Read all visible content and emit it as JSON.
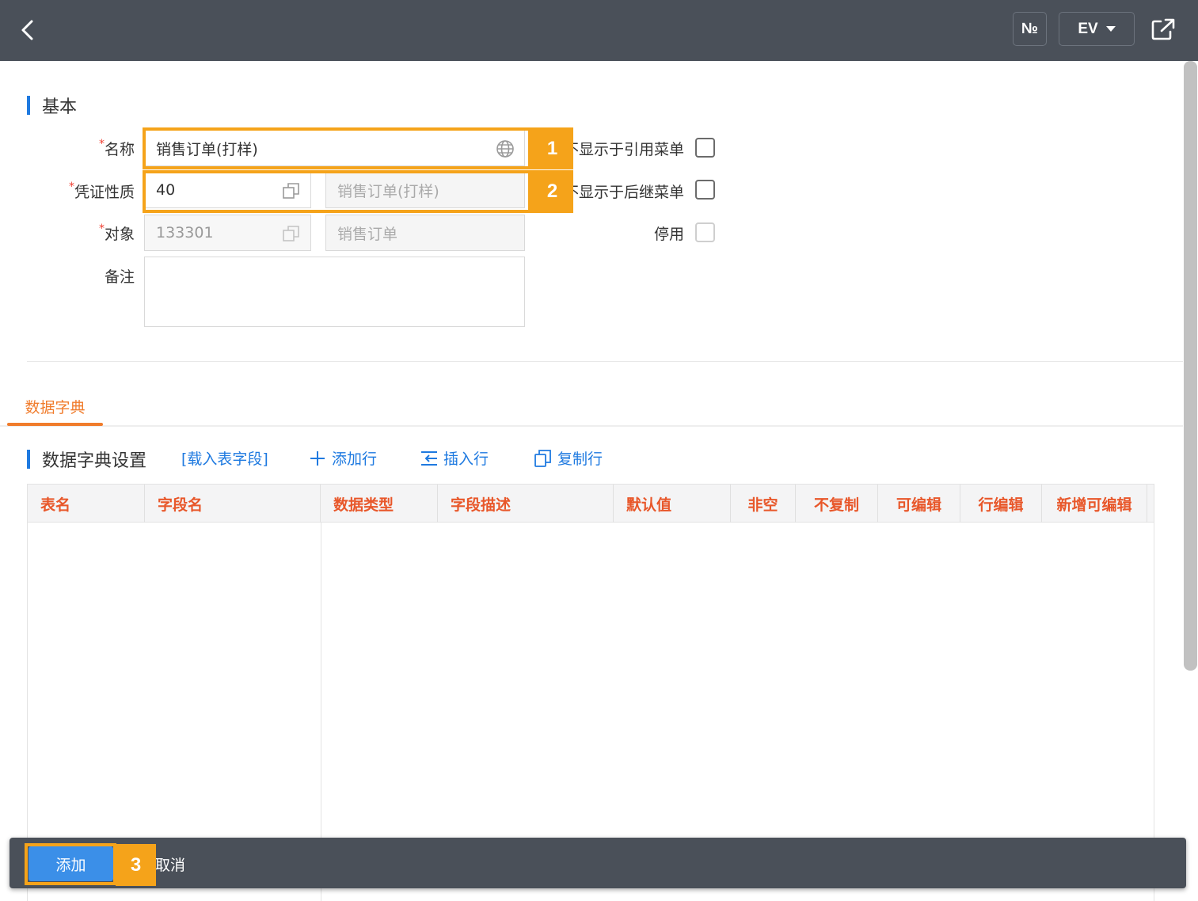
{
  "topbar": {
    "number_btn": "№",
    "lang_btn": "EV"
  },
  "basic": {
    "title": "基本",
    "name_label": "名称",
    "name_value": "销售订单(打样)",
    "voucher_label": "凭证性质",
    "voucher_code": "40",
    "voucher_desc": "销售订单(打样)",
    "object_label": "对象",
    "object_code": "133301",
    "object_desc": "销售订单",
    "remark_label": "备注",
    "required_mark": "*",
    "chk_ref_menu": "不显示于引用菜单",
    "chk_succ_menu": "不显示于后继菜单",
    "chk_disable": "停用"
  },
  "tab": {
    "label": "数据字典"
  },
  "dict": {
    "title": "数据字典设置",
    "load_fields": "[载入表字段]",
    "add_row": "添加行",
    "insert_row": "插入行",
    "copy_row": "复制行",
    "columns": [
      "表名",
      "字段名",
      "数据类型",
      "字段描述",
      "默认值",
      "非空",
      "不复制",
      "可编辑",
      "行编辑",
      "新增可编辑"
    ]
  },
  "actions": {
    "add": "添加",
    "cancel": "取消"
  },
  "annotations": [
    "1",
    "2",
    "3"
  ],
  "colors": {
    "topbar": "#4a5059",
    "accent_blue": "#1f7ae0",
    "tab_orange": "#f07c2c",
    "header_text": "#e8572a",
    "highlight": "#f5a31a"
  }
}
